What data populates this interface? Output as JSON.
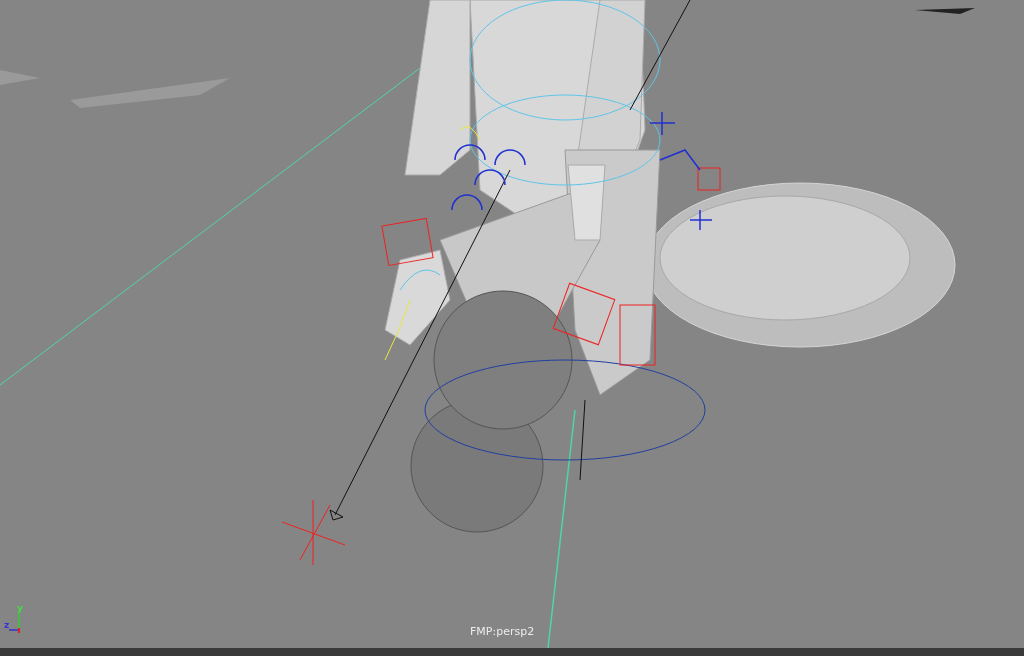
{
  "viewport": {
    "camera_label": "FMP:persp2",
    "axis_gizmo": {
      "y_label": "y",
      "z_label": "z"
    }
  }
}
